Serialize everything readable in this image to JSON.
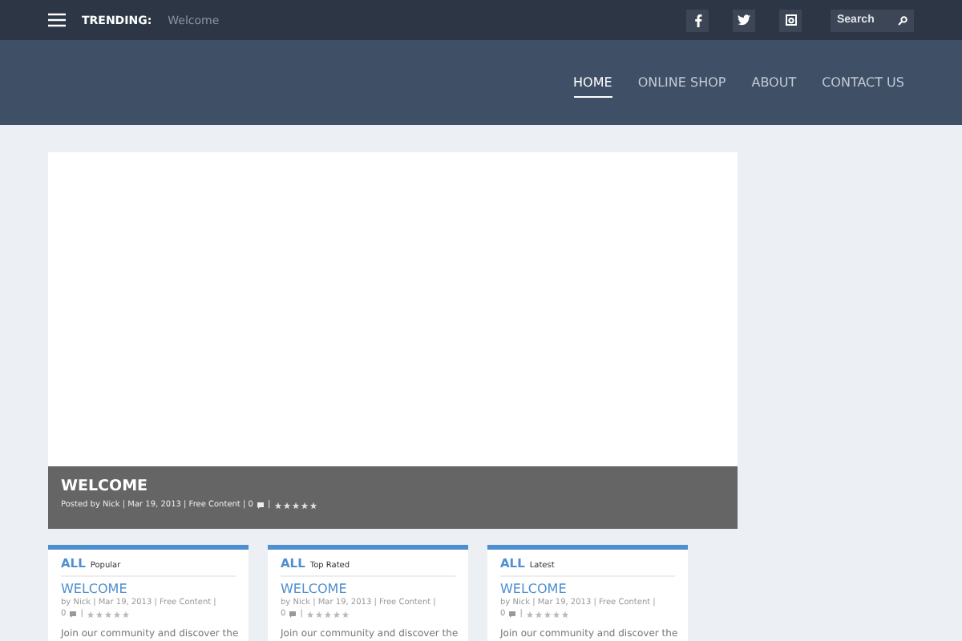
{
  "top_bar": {
    "trending_label": "TRENDING:",
    "trending_item": "Welcome",
    "search": {
      "placeholder": "Search"
    }
  },
  "nav": [
    {
      "label": "HOME",
      "selected": true
    },
    {
      "label": "ONLINE SHOP",
      "selected": false
    },
    {
      "label": "ABOUT",
      "selected": false
    },
    {
      "label": "CONTACT US",
      "selected": false
    }
  ],
  "featured": {
    "title": "WELCOME",
    "meta": "Posted by Nick | Mar 19, 2013 | Free Content | 0",
    "separator": "|"
  },
  "cards": [
    {
      "heading": "ALL",
      "subheading": "Popular",
      "title": "WELCOME",
      "meta": "by Nick | Mar 19, 2013 | Free Content |",
      "comments": "0",
      "separator": "|",
      "excerpt": "Join our community and discover the"
    },
    {
      "heading": "ALL",
      "subheading": "Top Rated",
      "title": "WELCOME",
      "meta": "by Nick | Mar 19, 2013 | Free Content |",
      "comments": "0",
      "separator": "|",
      "excerpt": "Join our community and discover the"
    },
    {
      "heading": "ALL",
      "subheading": "Latest",
      "title": "WELCOME",
      "meta": "by Nick | Mar 19, 2013 | Free Content |",
      "comments": "0",
      "separator": "|",
      "excerpt": "Join our community and discover the"
    }
  ]
}
